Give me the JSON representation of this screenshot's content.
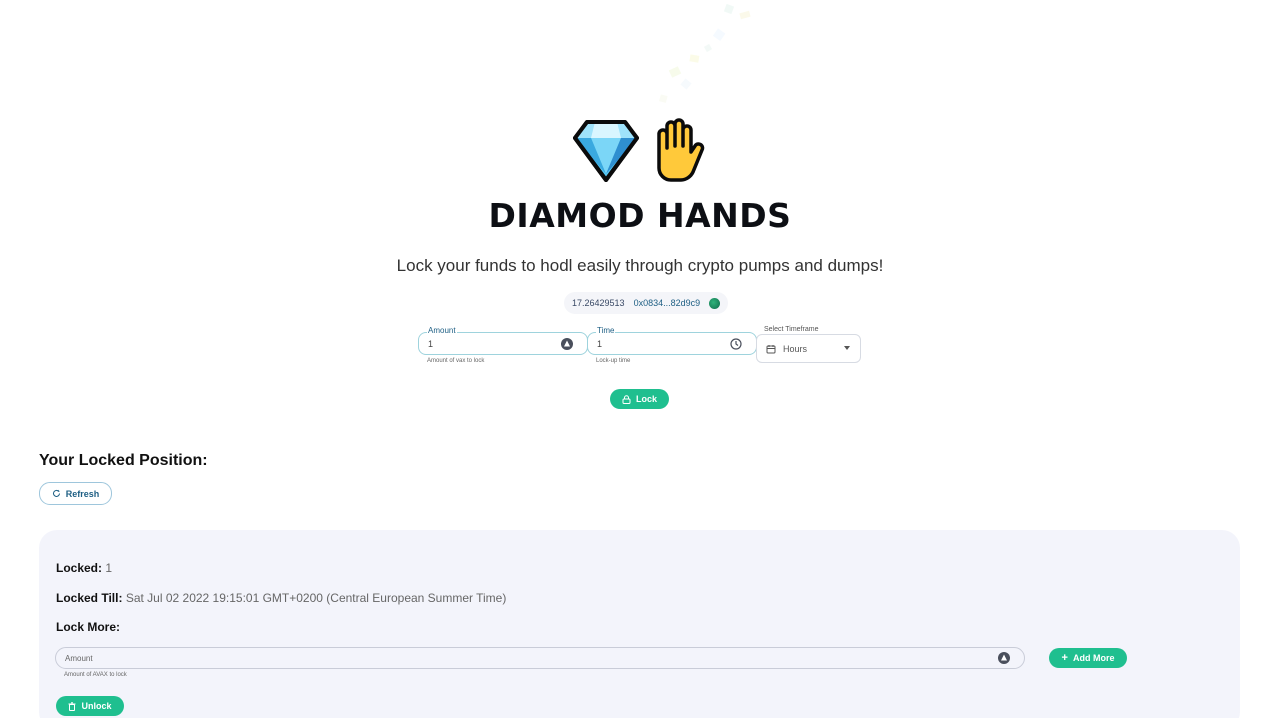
{
  "header": {
    "title": "DIAMOD HANDS",
    "subtitle": "Lock your funds to hodl easily through crypto pumps and dumps!"
  },
  "wallet": {
    "balance": "17.26429513",
    "address": "0x0834...82d9c9"
  },
  "lock_form": {
    "amount": {
      "label": "Amount",
      "value": "1",
      "helper": "Amount of vax to lock"
    },
    "time": {
      "label": "Time",
      "value": "1",
      "helper": "Lock-up time"
    },
    "timeframe": {
      "label": "Select Timeframe",
      "selected": "Hours"
    },
    "lock_button": "Lock"
  },
  "position": {
    "section_title": "Your Locked Position:",
    "refresh_button": "Refresh",
    "locked_label": "Locked:",
    "locked_value": "1",
    "locked_till_label": "Locked Till:",
    "locked_till_value": "Sat Jul 02 2022 19:15:01 GMT+0200 (Central European Summer Time)",
    "lock_more_label": "Lock More:",
    "amount_placeholder": "Amount",
    "amount_helper": "Amount of AVAX to lock",
    "add_more_button": "Add More",
    "unlock_button": "Unlock"
  },
  "colors": {
    "accent_green": "#1fbf8f",
    "link_blue": "#1e5f84",
    "card_bg": "#f3f4fb"
  }
}
